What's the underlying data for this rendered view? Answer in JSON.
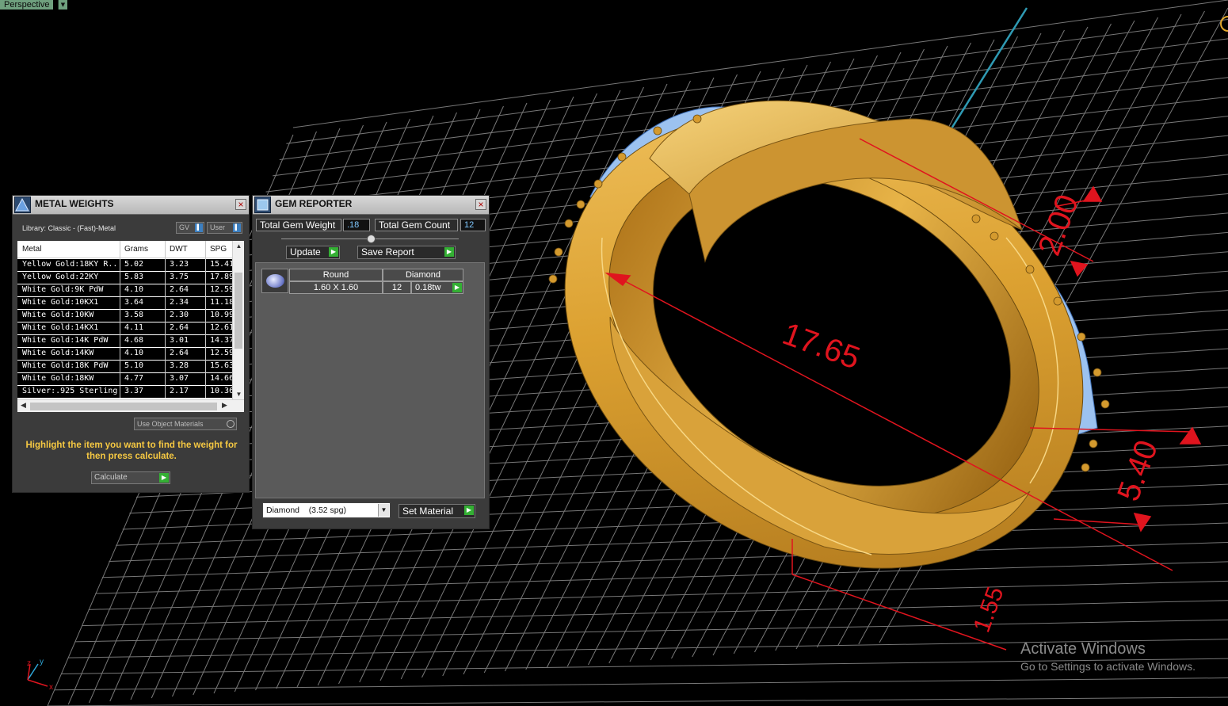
{
  "viewport": {
    "label": "Perspective",
    "dimensions": {
      "top": "2.00",
      "width": "17.65",
      "height": "5.40",
      "shank": "1.55"
    },
    "axes": {
      "x": "x",
      "y": "y",
      "z": "z"
    }
  },
  "metal_weights": {
    "title": "METAL WEIGHTS",
    "library": "Library: Classic - (Fast)-Metal",
    "gv_label": "GV",
    "user_label": "User",
    "columns": [
      "Metal",
      "Grams",
      "DWT",
      "SPG"
    ],
    "rows": [
      [
        "Yellow Gold:18KY R...",
        "5.02",
        "3.23",
        "15.41"
      ],
      [
        "Yellow Gold:22KY",
        "5.83",
        "3.75",
        "17.89"
      ],
      [
        "White Gold:9K PdW",
        "4.10",
        "2.64",
        "12.59"
      ],
      [
        "White Gold:10KX1",
        "3.64",
        "2.34",
        "11.18"
      ],
      [
        "White Gold:10KW",
        "3.58",
        "2.30",
        "10.99"
      ],
      [
        "White Gold:14KX1",
        "4.11",
        "2.64",
        "12.61"
      ],
      [
        "White Gold:14K PdW",
        "4.68",
        "3.01",
        "14.37"
      ],
      [
        "White Gold:14KW",
        "4.10",
        "2.64",
        "12.59"
      ],
      [
        "White Gold:18K PdW",
        "5.10",
        "3.28",
        "15.63"
      ],
      [
        "White Gold:18KW",
        "4.77",
        "3.07",
        "14.66"
      ],
      [
        "Silver:.925 Sterling",
        "3.37",
        "2.17",
        "10.36"
      ]
    ],
    "use_object_materials": "Use Object Materials",
    "hint": "Highlight the item you want to find the weight for then press calculate.",
    "calculate": "Calculate"
  },
  "gem_reporter": {
    "title": "GEM REPORTER",
    "total_weight_label": "Total Gem Weight",
    "total_weight_value": ".18",
    "total_count_label": "Total Gem Count",
    "total_count_value": "12",
    "update": "Update",
    "save_report": "Save Report",
    "gem": {
      "shape": "Round",
      "material": "Diamond",
      "size": "1.60 X 1.60",
      "count": "12",
      "weight": "0.18tw"
    },
    "material_select": "Diamond    (3.52 spg)",
    "set_material": "Set Material"
  },
  "watermark": {
    "title": "Activate Windows",
    "subtitle": "Go to Settings to activate Windows."
  },
  "colors": {
    "gold": "#e0a62a",
    "dimension": "#e0141e",
    "gem": "#8fb8ef",
    "grid": "#9a9a9a"
  }
}
